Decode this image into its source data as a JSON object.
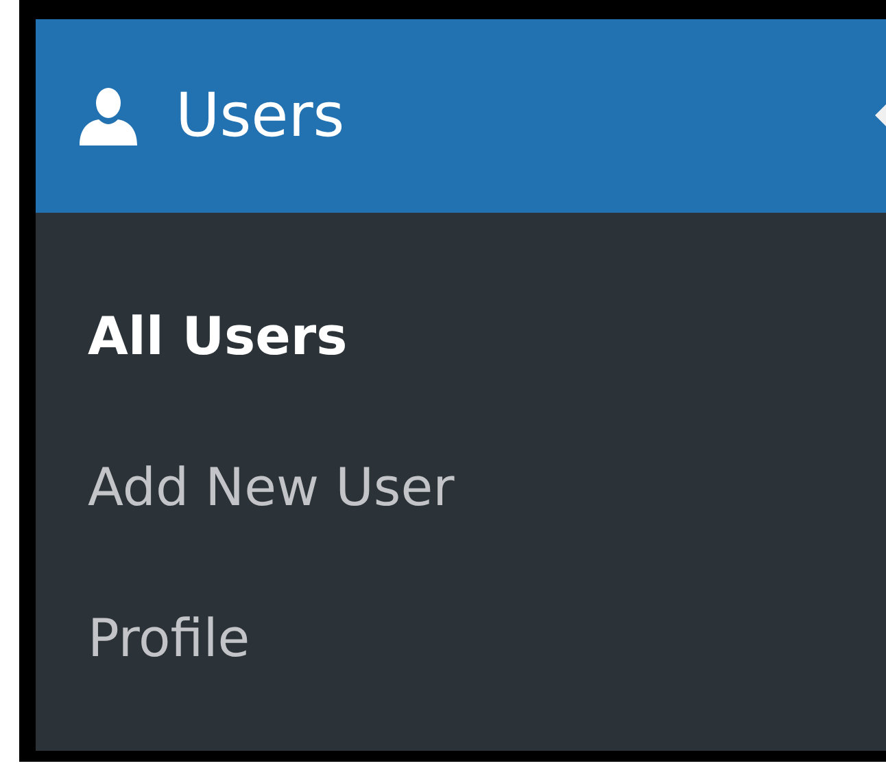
{
  "menu": {
    "label": "Users",
    "current": true
  },
  "submenu": [
    {
      "label": "All Users",
      "selected": true
    },
    {
      "label": "Add New User",
      "selected": false
    },
    {
      "label": "Profile",
      "selected": false
    }
  ]
}
